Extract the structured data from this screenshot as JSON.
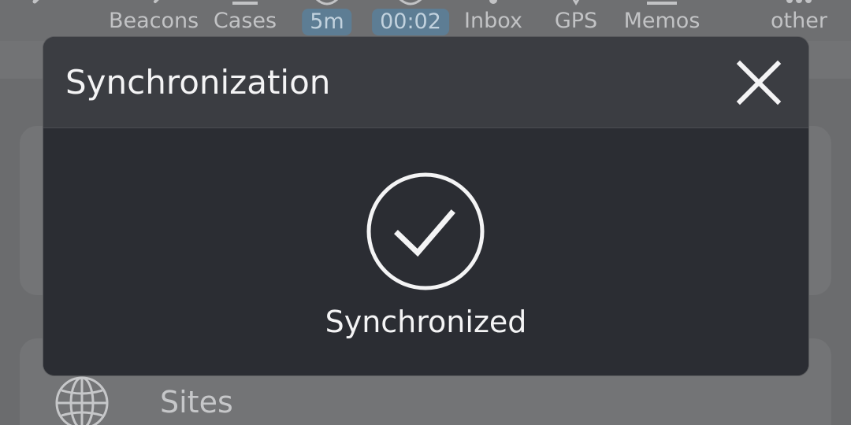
{
  "toolbar": {
    "items": [
      {
        "label": "Beacons",
        "icon": "beacon-icon"
      },
      {
        "label": "Cases",
        "icon": "cases-icon"
      },
      {
        "badge": "5m",
        "icon": "timer-icon"
      },
      {
        "badge": "00:02",
        "icon": "clock-icon"
      },
      {
        "label": "Inbox",
        "icon": "inbox-icon"
      },
      {
        "label": "GPS",
        "icon": "gps-icon"
      },
      {
        "label": "Memos",
        "icon": "memos-icon"
      },
      {
        "label": "other",
        "icon": "more-icon"
      }
    ]
  },
  "background": {
    "sites_label": "Sites",
    "sites_icon": "globe-icon"
  },
  "dialog": {
    "title": "Synchronization",
    "close_icon": "close-icon",
    "status_icon": "check-circle-icon",
    "status_text": "Synchronized"
  },
  "colors": {
    "dialog_body": "#2b2d33",
    "dialog_header": "#3b3d42",
    "badge": "#5d7d94",
    "text": "#f4f4f5"
  }
}
